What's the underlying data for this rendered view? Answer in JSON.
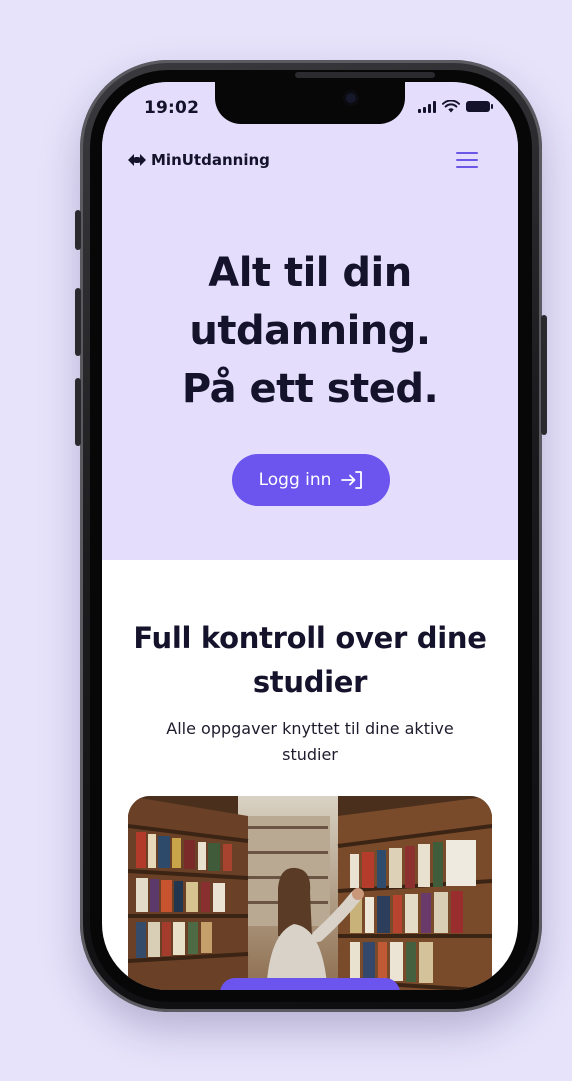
{
  "status_bar": {
    "time": "19:02"
  },
  "nav": {
    "brand": "MinUtdanning"
  },
  "hero": {
    "title_lines": [
      "Alt til din",
      "utdanning.",
      "På ett sted."
    ],
    "login_label": "Logg inn"
  },
  "section": {
    "title_lines": [
      "Full kontroll over dine",
      "studier"
    ],
    "subtitle_lines": [
      "Alle oppgaver knyttet til dine aktive",
      "studier"
    ]
  },
  "colors": {
    "page_background": "#e7e3fb",
    "hero_background": "#e4defc",
    "accent": "#6c54ee",
    "text_dark": "#15122b"
  },
  "icons": {
    "brand": "logo-mark-icon",
    "menu": "hamburger-menu-icon",
    "login": "login-arrow-icon",
    "signal": "cellular-signal-icon",
    "wifi": "wifi-icon",
    "battery": "battery-icon"
  }
}
